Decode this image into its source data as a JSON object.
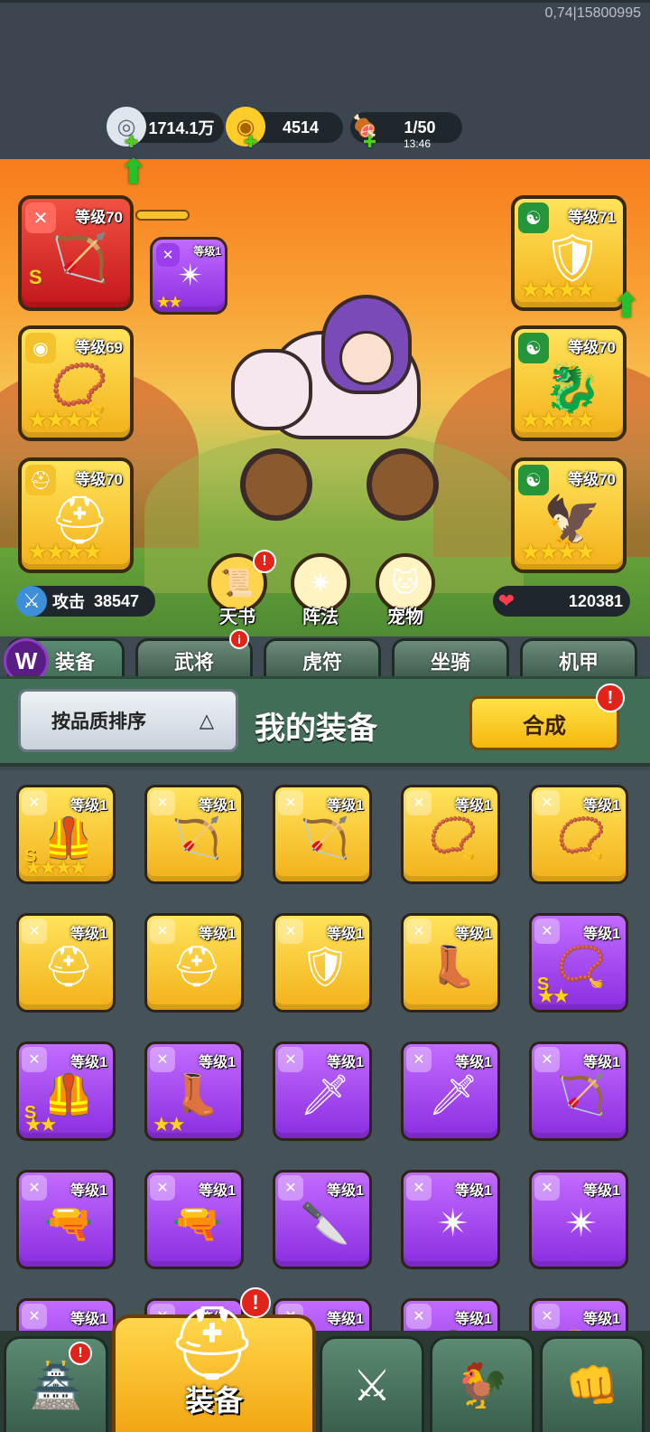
{
  "build_info": "0,74|15800995",
  "resources": [
    {
      "icon": "silver-coin-icon",
      "glyph": "◎",
      "value": "1714.1万",
      "timer": ""
    },
    {
      "icon": "gold-ingot-icon",
      "glyph": "◉",
      "value": "4514",
      "timer": ""
    },
    {
      "icon": "meat-stamina-icon",
      "glyph": "🍖",
      "value": "1/50",
      "timer": "13:46"
    }
  ],
  "left_slots": [
    {
      "level": "等级70",
      "rank": "S",
      "stars": "",
      "category": "sword",
      "cat_glyph": "✕",
      "art": "🏹",
      "bg": "red"
    },
    {
      "level": "等级69",
      "rank": "",
      "stars": "★★★★",
      "category": "amulet",
      "cat_glyph": "◉",
      "art": "📿",
      "bg": "gold"
    },
    {
      "level": "等级70",
      "rank": "",
      "stars": "★★★★",
      "category": "helmet",
      "cat_glyph": "⛑",
      "art": "⛑",
      "bg": "gold"
    }
  ],
  "hidden_weapon": {
    "level": "等级1",
    "stars": "★★",
    "art": "✴"
  },
  "right_slots": [
    {
      "level": "等级71",
      "stars": "★★★★",
      "art": "🛡"
    },
    {
      "level": "等级70",
      "stars": "★★★★",
      "art": "🐉"
    },
    {
      "level": "等级70",
      "stars": "★★★★",
      "art": "🦅"
    }
  ],
  "stats": {
    "attack_label": "攻击",
    "attack_value": "38547",
    "hp_value": "120381"
  },
  "features": [
    {
      "label": "天书",
      "glyph": "📜",
      "badge": "!"
    },
    {
      "label": "阵法",
      "glyph": "✷",
      "badge": ""
    },
    {
      "label": "宠物",
      "glyph": "🐱",
      "badge": ""
    }
  ],
  "tabs": [
    {
      "label": "装备",
      "badge": ""
    },
    {
      "label": "武将",
      "badge": "i"
    },
    {
      "label": "虎符",
      "badge": ""
    },
    {
      "label": "坐骑",
      "badge": ""
    },
    {
      "label": "机甲",
      "badge": ""
    }
  ],
  "logo_letter": "W",
  "sort_label": "按品质排序",
  "sort_arrow": "△",
  "section_title": "我的装备",
  "compose_label": "合成",
  "compose_badge": "!",
  "inventory": [
    {
      "level": "等级1",
      "bg": "gold",
      "rank": "S",
      "stars": "★★★★",
      "art": "🦺"
    },
    {
      "level": "等级1",
      "bg": "gold",
      "rank": "",
      "stars": "",
      "art": "🏹"
    },
    {
      "level": "等级1",
      "bg": "gold",
      "rank": "",
      "stars": "",
      "art": "🏹"
    },
    {
      "level": "等级1",
      "bg": "gold",
      "rank": "",
      "stars": "",
      "art": "📿"
    },
    {
      "level": "等级1",
      "bg": "gold",
      "rank": "",
      "stars": "",
      "art": "📿"
    },
    {
      "level": "等级1",
      "bg": "gold",
      "rank": "",
      "stars": "",
      "art": "⛑"
    },
    {
      "level": "等级1",
      "bg": "gold",
      "rank": "",
      "stars": "",
      "art": "⛑"
    },
    {
      "level": "等级1",
      "bg": "gold",
      "rank": "",
      "stars": "",
      "art": "🛡"
    },
    {
      "level": "等级1",
      "bg": "gold",
      "rank": "",
      "stars": "",
      "art": "👢"
    },
    {
      "level": "等级1",
      "bg": "purple",
      "rank": "S",
      "stars": "★★",
      "art": "📿"
    },
    {
      "level": "等级1",
      "bg": "purple",
      "rank": "S",
      "stars": "★★",
      "art": "🦺"
    },
    {
      "level": "等级1",
      "bg": "purple",
      "rank": "",
      "stars": "★★",
      "art": "👢"
    },
    {
      "level": "等级1",
      "bg": "purple",
      "rank": "",
      "stars": "",
      "art": "🗡"
    },
    {
      "level": "等级1",
      "bg": "purple",
      "rank": "",
      "stars": "",
      "art": "🗡"
    },
    {
      "level": "等级1",
      "bg": "purple",
      "rank": "",
      "stars": "",
      "art": "🏹"
    },
    {
      "level": "等级1",
      "bg": "purple",
      "rank": "",
      "stars": "",
      "art": "🔫"
    },
    {
      "level": "等级1",
      "bg": "purple",
      "rank": "",
      "stars": "",
      "art": "🔫"
    },
    {
      "level": "等级1",
      "bg": "purple",
      "rank": "",
      "stars": "",
      "art": "🔪"
    },
    {
      "level": "等级1",
      "bg": "purple",
      "rank": "",
      "stars": "",
      "art": "✴"
    },
    {
      "level": "等级1",
      "bg": "purple",
      "rank": "",
      "stars": "",
      "art": "✴"
    },
    {
      "level": "等级1",
      "bg": "purple",
      "rank": "",
      "stars": "",
      "art": "🗡"
    },
    {
      "level": "等级1",
      "bg": "purple",
      "rank": "",
      "stars": "",
      "art": "🗡"
    },
    {
      "level": "等级1",
      "bg": "purple",
      "rank": "",
      "stars": "",
      "art": "🗡"
    },
    {
      "level": "等级1",
      "bg": "purple",
      "rank": "",
      "stars": "",
      "art": "🦺"
    },
    {
      "level": "等级1",
      "bg": "purple",
      "rank": "",
      "stars": "",
      "art": "👢"
    }
  ],
  "bottom_nav": [
    {
      "name": "shop",
      "glyph": "🏯",
      "badge": "!"
    },
    {
      "name": "equipment",
      "label": "装备",
      "glyph": "⛑",
      "badge": "!"
    },
    {
      "name": "battle",
      "glyph": "⚔",
      "badge": ""
    },
    {
      "name": "heroes",
      "glyph": "🐓",
      "badge": ""
    },
    {
      "name": "upgrade",
      "glyph": "👊",
      "badge": ""
    }
  ]
}
